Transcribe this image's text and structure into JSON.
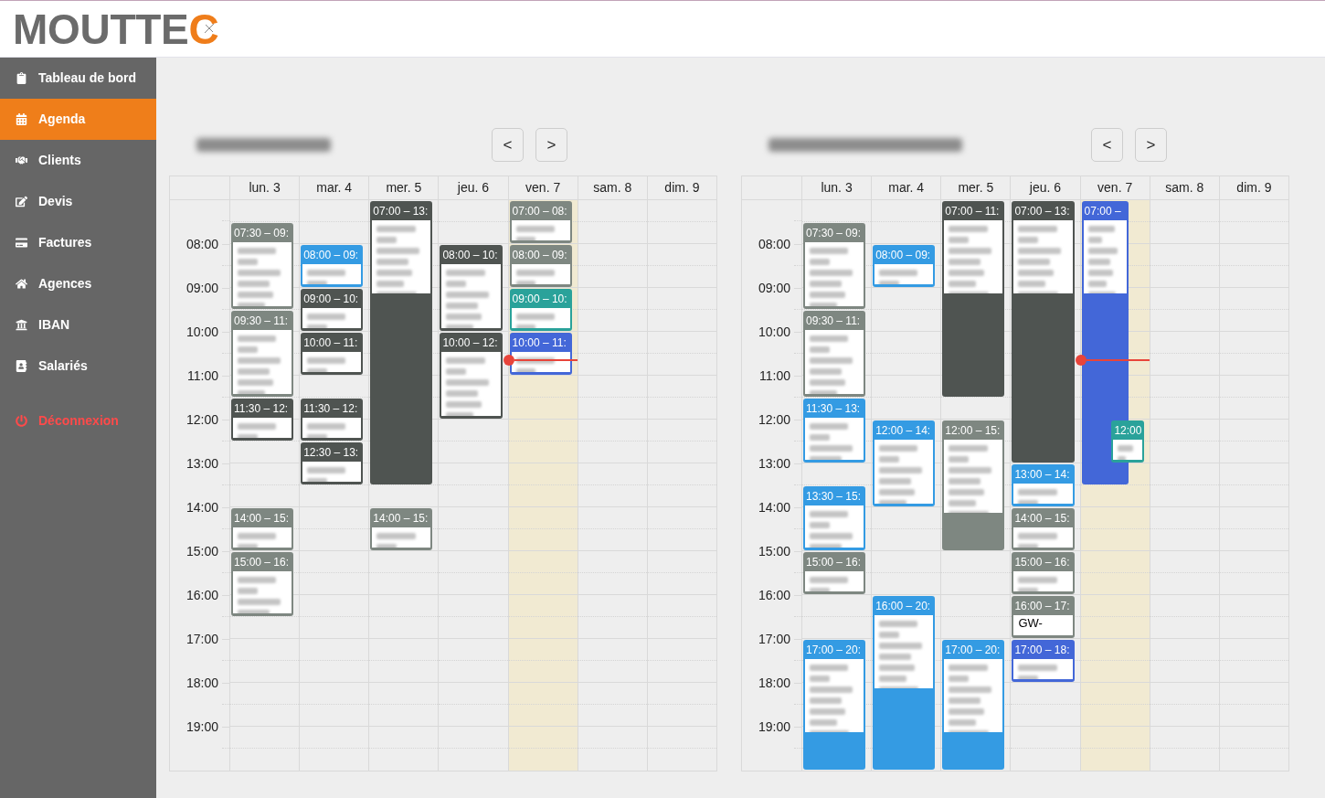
{
  "logo": {
    "text": "MOUTTEC"
  },
  "sidebar": {
    "items": [
      {
        "label": "Tableau de bord",
        "selected": false
      },
      {
        "label": "Agenda",
        "selected": true
      },
      {
        "label": "Clients",
        "selected": false
      },
      {
        "label": "Devis",
        "selected": false
      },
      {
        "label": "Factures",
        "selected": false
      },
      {
        "label": "Agences",
        "selected": false
      },
      {
        "label": "IBAN",
        "selected": false
      },
      {
        "label": "Salariés",
        "selected": false
      }
    ],
    "logout": {
      "label": "Déconnexion"
    }
  },
  "calendars": [
    {
      "nav": [
        "<",
        ">"
      ],
      "hours": [
        "08:00",
        "09:00",
        "10:00",
        "11:00",
        "12:00",
        "13:00",
        "14:00",
        "15:00",
        "16:00",
        "17:00",
        "18:00",
        "19:00"
      ],
      "days": [
        {
          "label": "lun. 3",
          "today": false,
          "events": [
            {
              "time": "07:30 – 09:",
              "color": "#7e8781"
            },
            {
              "time": "09:30 – 11:",
              "color": "#7e8781"
            },
            {
              "time": "11:30 – 12:",
              "color": "#4f5451"
            },
            {
              "time": "14:00 – 15:",
              "color": "#7e8781"
            },
            {
              "time": "15:00 – 16:",
              "color": "#7e8781"
            }
          ]
        },
        {
          "label": "mar. 4",
          "today": false,
          "events": [
            {
              "time": "08:00 – 09:",
              "color": "#349be3"
            },
            {
              "time": "09:00 – 10:",
              "color": "#4f5451"
            },
            {
              "time": "10:00 – 11:",
              "color": "#4f5451"
            },
            {
              "time": "11:30 – 12:",
              "color": "#4f5451"
            },
            {
              "time": "12:30 – 13:",
              "color": "#4f5451"
            }
          ]
        },
        {
          "label": "mer. 5",
          "today": false,
          "events": [
            {
              "time": "07:00 – 13:",
              "color": "#4f5451"
            },
            {
              "time": "14:00 – 15:",
              "color": "#7e8781"
            }
          ]
        },
        {
          "label": "jeu. 6",
          "today": false,
          "events": [
            {
              "time": "08:00 – 10:",
              "color": "#4f5451"
            },
            {
              "time": "10:00 – 12:",
              "color": "#4f5451"
            }
          ]
        },
        {
          "label": "ven. 7",
          "today": true,
          "events": [
            {
              "time": "07:00 – 08:",
              "color": "#7e8781"
            },
            {
              "time": "08:00 – 09:",
              "color": "#7e8781"
            },
            {
              "time": "09:00 – 10:",
              "color": "#2aa29a"
            },
            {
              "time": "10:00 – 11:",
              "color": "#4367d8"
            }
          ]
        },
        {
          "label": "sam. 8",
          "today": false
        },
        {
          "label": "dim. 9",
          "today": false
        }
      ]
    },
    {
      "nav": [
        "<",
        ">"
      ],
      "hours": [
        "08:00",
        "09:00",
        "10:00",
        "11:00",
        "12:00",
        "13:00",
        "14:00",
        "15:00",
        "16:00",
        "17:00",
        "18:00",
        "19:00"
      ],
      "days": [
        {
          "label": "lun. 3",
          "today": false,
          "events": [
            {
              "time": "07:30 – 09:",
              "color": "#7e8781"
            },
            {
              "time": "09:30 – 11:",
              "color": "#7e8781"
            },
            {
              "time": "11:30 – 13:",
              "color": "#349be3"
            },
            {
              "time": "13:30 – 15:",
              "color": "#349be3"
            },
            {
              "time": "15:00 – 16:",
              "color": "#7e8781"
            },
            {
              "time": "17:00 – 20:",
              "color": "#349be3"
            }
          ]
        },
        {
          "label": "mar. 4",
          "today": false,
          "events": [
            {
              "time": "08:00 – 09:",
              "color": "#349be3"
            },
            {
              "time": "12:00 – 14:",
              "color": "#349be3"
            },
            {
              "time": "16:00 – 20:",
              "color": "#349be3"
            }
          ]
        },
        {
          "label": "mer. 5",
          "today": false,
          "events": [
            {
              "time": "07:00 – 11:",
              "color": "#4f5451"
            },
            {
              "time": "12:00 – 15:",
              "color": "#7e8781"
            },
            {
              "time": "17:00 – 20:",
              "color": "#349be3"
            }
          ]
        },
        {
          "label": "jeu. 6",
          "today": false,
          "events": [
            {
              "time": "07:00 – 13:",
              "color": "#4f5451"
            },
            {
              "time": "13:00 – 14:",
              "color": "#349be3"
            },
            {
              "time": "14:00 – 15:",
              "color": "#7e8781"
            },
            {
              "time": "15:00 – 16:",
              "color": "#7e8781"
            },
            {
              "time": "16:00 – 17:",
              "color": "#7e8781",
              "details": "GW-"
            },
            {
              "time": "17:00 – 18:",
              "color": "#4367d8"
            }
          ]
        },
        {
          "label": "ven. 7",
          "today": true,
          "events": [
            {
              "time": "07:00 –",
              "color": "#4367d8"
            },
            {
              "time": "12:00",
              "color": "#2aa29a"
            }
          ]
        },
        {
          "label": "sam. 8",
          "today": false
        },
        {
          "label": "dim. 9",
          "today": false
        }
      ]
    }
  ]
}
